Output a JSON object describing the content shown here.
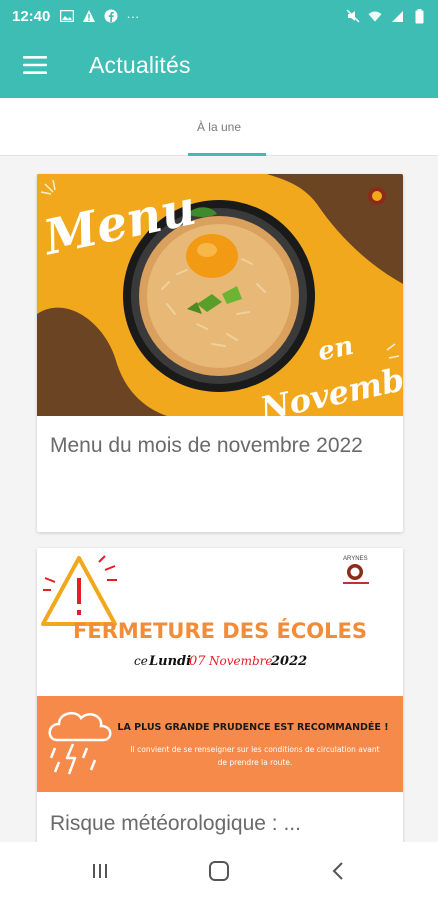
{
  "status_bar": {
    "time": "12:40",
    "left_icons": [
      "image-icon",
      "warning-icon",
      "facebook-icon",
      "more-icon"
    ],
    "right_icons": [
      "mute-icon",
      "wifi-icon",
      "signal-icon",
      "battery-icon"
    ],
    "more": "···"
  },
  "app_bar": {
    "title": "Actualités",
    "color": "#3dbdb4"
  },
  "tabs": [
    {
      "label": "À la une",
      "selected": true
    }
  ],
  "articles": [
    {
      "title": "Menu du mois de novembre 2022",
      "image_text": {
        "menu": "Menu",
        "en": "en",
        "month": "Novembre"
      }
    },
    {
      "title": "Risque météorologique : ...",
      "image_text": {
        "logo": "ARYNES",
        "headline": "FERMETURE DES ÉCOLES",
        "date_prefix": "ce",
        "date_day": "Lundi",
        "date_number": "07",
        "date_month": "Novembre",
        "date_year": "2022",
        "warning_title": "LA PLUS GRANDE PRUDENCE EST RECOMMANDÉE !",
        "warning_text": "Il convient de se renseigner sur les conditions de circulation avant de prendre la route."
      }
    }
  ],
  "nav_bar": [
    "recent-apps-icon",
    "home-icon",
    "back-icon"
  ]
}
